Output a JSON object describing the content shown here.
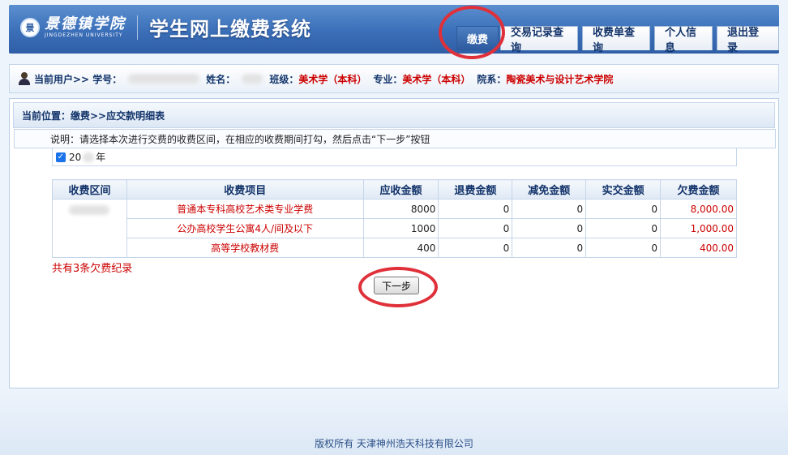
{
  "header": {
    "logo_seal": "景",
    "logo_cn": "景德镇学院",
    "logo_en": "JINGDEZHEN UNIVERSITY",
    "system_title": "学生网上缴费系统",
    "nav": [
      {
        "label": "缴费",
        "active": true
      },
      {
        "label": "交易记录查询",
        "active": false
      },
      {
        "label": "收费单查询",
        "active": false
      },
      {
        "label": "个人信息",
        "active": false
      },
      {
        "label": "退出登录",
        "active": false
      }
    ]
  },
  "userbar": {
    "current_user_label": "当前用户>> 学号：",
    "name_label": "姓名：",
    "class_label": "班级：",
    "class_value": "美术学（本科）",
    "major_label": "专业：",
    "major_value": "美术学（本科）",
    "dept_label": "院系：",
    "dept_value": "陶瓷美术与设计艺术学院"
  },
  "breadcrumb": "当前位置：缴费>>应交款明细表",
  "instruction": "说明：请选择本次进行交费的收费区间，在相应的收费期间打勾，然后点击“下一步”按钮",
  "term": {
    "prefix": "20",
    "suffix": "年",
    "checked": true
  },
  "table": {
    "headers": [
      "收费区间",
      "收费项目",
      "应收金额",
      "退费金额",
      "减免金额",
      "实交金额",
      "欠费金额"
    ],
    "rows": [
      {
        "item": "普通本专科高校艺术类专业学费",
        "receivable": "8000",
        "refund": "0",
        "waiver": "0",
        "paid": "0",
        "owed": "8,000.00"
      },
      {
        "item": "公办高校学生公寓4人/间及以下",
        "receivable": "1000",
        "refund": "0",
        "waiver": "0",
        "paid": "0",
        "owed": "1,000.00"
      },
      {
        "item": "高等学校教材费",
        "receivable": "400",
        "refund": "0",
        "waiver": "0",
        "paid": "0",
        "owed": "400.00"
      }
    ]
  },
  "count_text": "共有3条欠费纪录",
  "next_button": "下一步",
  "footer": "版权所有 天津神州浩天科技有限公司",
  "colors": {
    "accent": "#2f5ea6",
    "highlight": "#e0303a",
    "owed": "#cc0000"
  }
}
